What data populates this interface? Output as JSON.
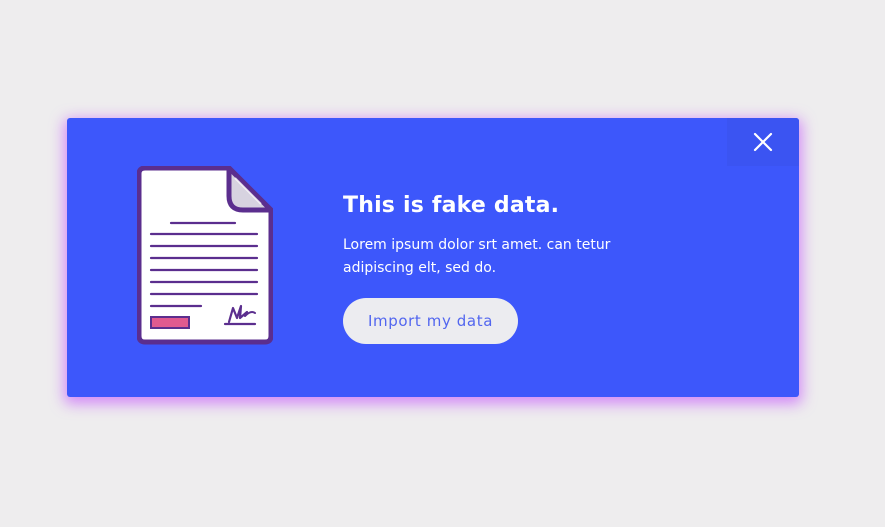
{
  "banner": {
    "title": "This is fake data.",
    "body": "Lorem ipsum dolor srt amet. can tetur adipiscing elt, sed do.",
    "cta_label": "Import my data",
    "close_icon": "close-icon",
    "illustration_icon": "document-icon"
  },
  "colors": {
    "page_background": "#eeedee",
    "banner_background": "#3d57fb",
    "banner_glow": "#be3cff",
    "cta_background": "#ececf0",
    "cta_text": "#5266ef",
    "document_outline": "#5b2e8e",
    "document_stamp": "#e05a8f"
  }
}
